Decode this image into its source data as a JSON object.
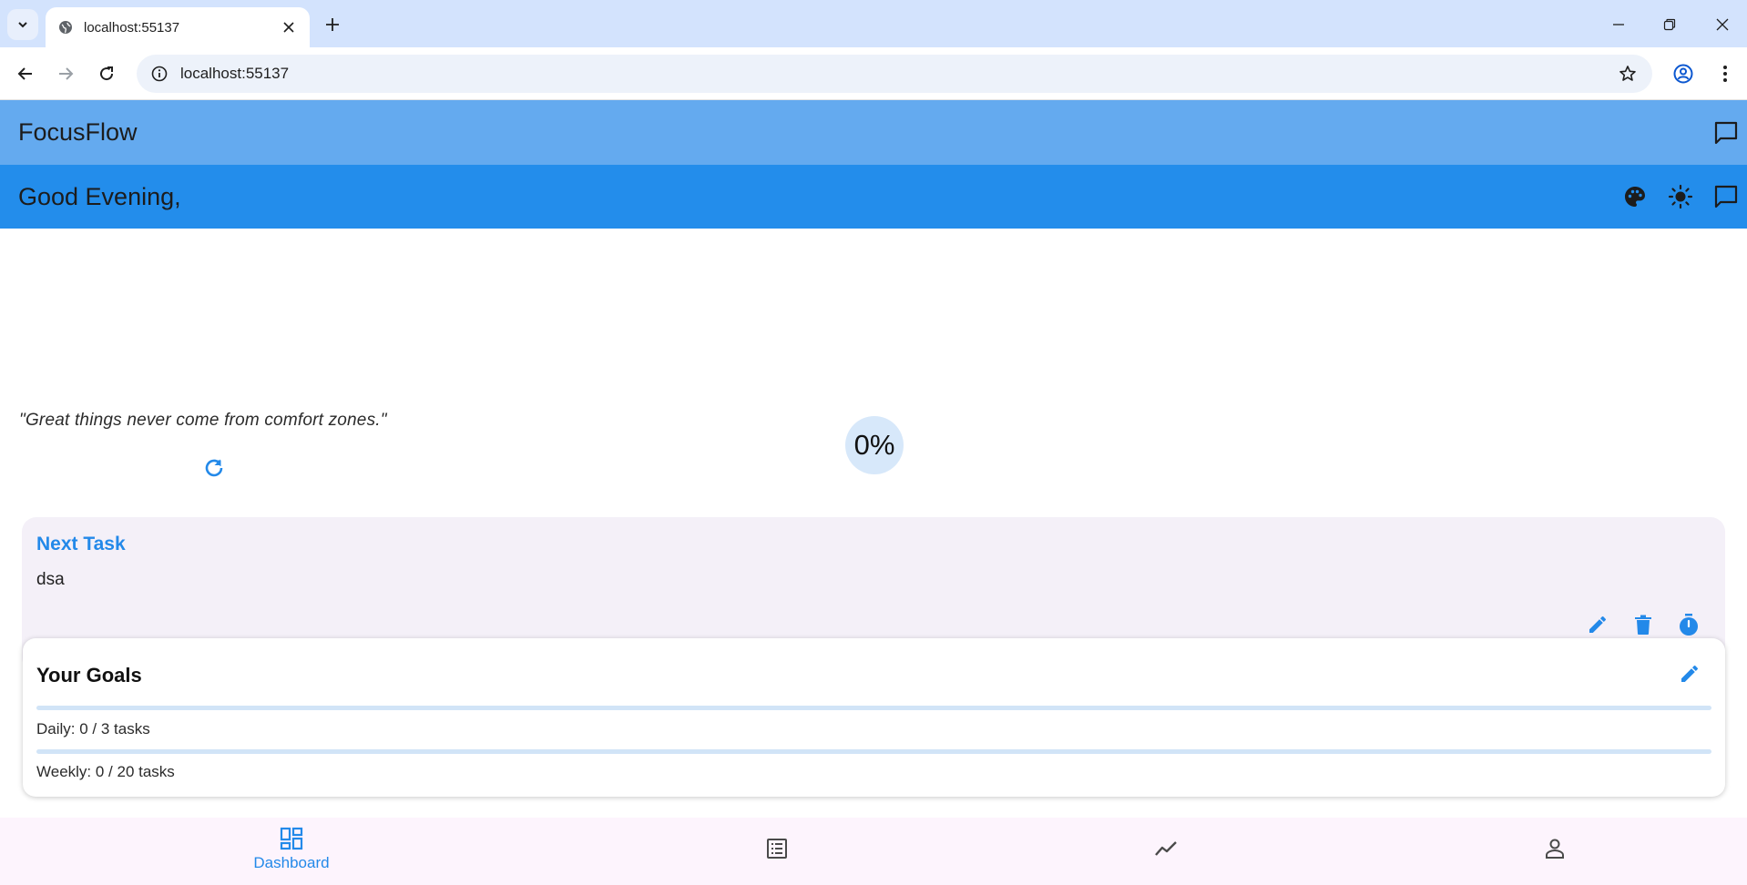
{
  "browser": {
    "tab_title": "localhost:55137",
    "url": "localhost:55137"
  },
  "app": {
    "title": "FocusFlow",
    "greeting": "Good Evening,",
    "quote": "\"Great things never come from comfort zones.\"",
    "progress_text": "0%",
    "accent_color": "#2389e9"
  },
  "next_task": {
    "label": "Next Task",
    "name": "dsa"
  },
  "goals": {
    "title": "Your Goals",
    "daily": {
      "text": "Daily: 0 / 3 tasks",
      "done": 0,
      "target": 3
    },
    "weekly": {
      "text": "Weekly: 0 / 20 tasks",
      "done": 0,
      "target": 20
    }
  },
  "bottom_nav": {
    "items": [
      {
        "label": "Dashboard",
        "icon": "dashboard-icon",
        "active": true
      },
      {
        "label": "",
        "icon": "list-icon",
        "active": false
      },
      {
        "label": "",
        "icon": "trend-icon",
        "active": false
      },
      {
        "label": "",
        "icon": "person-icon",
        "active": false
      }
    ]
  }
}
